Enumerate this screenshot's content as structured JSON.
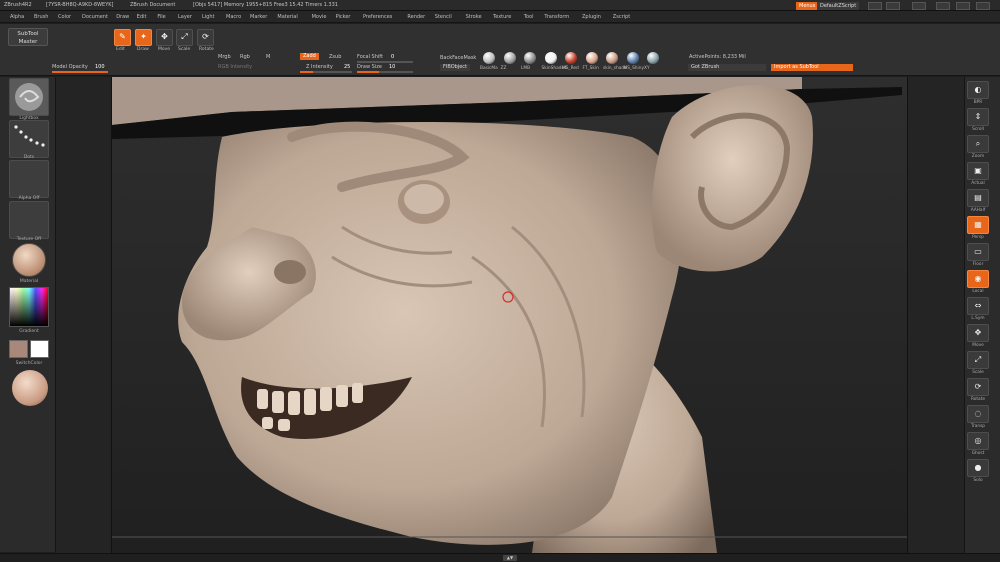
{
  "titlebar": {
    "app": "ZBrush4R2",
    "serial": "[7YSR-BH8Q-A9KD-8WEYK]",
    "doc": "ZBrush Document",
    "stats": "[Objs 5417] Memory 1955+815 Free3 15.42 Timers 1.331",
    "menus_label": "Menus",
    "script_label": "DefaultZScript"
  },
  "menubar": {
    "items": [
      "Alpha",
      "Brush",
      "Color",
      "Document",
      "Draw",
      "Edit",
      "File",
      "Layer",
      "Light",
      "Macro",
      "Marker",
      "Material",
      "Movie",
      "Picker",
      "Preferences",
      "Render",
      "Stencil",
      "Stroke",
      "Texture",
      "Tool",
      "Transform",
      "Zplugin",
      "Zscript"
    ]
  },
  "shelf": {
    "subtool_master": [
      "SubTool",
      "Master"
    ],
    "model_opacity_label": "Model Opacity",
    "model_opacity_value": "100",
    "model_opacity": 1.0,
    "tools": [
      {
        "label": "Edit",
        "icon": "edit-icon",
        "glyph": "✎",
        "on": true
      },
      {
        "label": "Draw",
        "icon": "draw-icon",
        "glyph": "✦",
        "on": true
      },
      {
        "label": "Move",
        "icon": "move-icon",
        "glyph": "✥",
        "on": false
      },
      {
        "label": "Scale",
        "icon": "scale-icon",
        "glyph": "⤢",
        "on": false
      },
      {
        "label": "Rotate",
        "icon": "rotate-icon",
        "glyph": "⟳",
        "on": false
      }
    ],
    "mrgb": "Mrgb",
    "rgb": "Rgb",
    "m": "M",
    "rgb_intensity": "RGB Intensity",
    "zadd": "Zadd",
    "zsub": "Zsub",
    "z_intensity_label": "Z Intensity",
    "z_intensity_value": "25",
    "z_intensity": 0.25,
    "focal_shift_label": "Focal Shift",
    "focal_shift_value": "0",
    "draw_size_label": "Draw Size",
    "draw_size_value": "10",
    "backface_mask": "BackFaceMask",
    "fiber_object": "FIBObject",
    "active_points": "ActivePoints: 8,233 Mil",
    "got_zbrush": "Got ZBrush",
    "import_as_subtool": "Import as SubTool"
  },
  "materials": [
    {
      "name": "BasicMa",
      "color": "#bdbdbd"
    },
    {
      "name": "ZZ",
      "color": "#a0a0a0"
    },
    {
      "name": "LMB",
      "color": "#8c8c8c"
    },
    {
      "name": "SkinShade4",
      "color": "#f0f0f0"
    },
    {
      "name": "MS_Red",
      "color": "#c8402a"
    },
    {
      "name": "FT_Skin",
      "color": "#d9a58c"
    },
    {
      "name": "skin_shade",
      "color": "#c89a82"
    },
    {
      "name": "MS_Shiny",
      "color": "#5a7fae"
    },
    {
      "name": "XY",
      "color": "#8aa0a8"
    }
  ],
  "lefttray": {
    "thumbs": [
      "Lightbox",
      "Dots",
      "Alpha Off",
      "Texture Off",
      "Material",
      "Gradient",
      "SwitchColor"
    ]
  },
  "righttray": {
    "buttons": [
      {
        "label": "BPR",
        "icon": "bpr-icon",
        "glyph": "◐",
        "on": false
      },
      {
        "label": "Scroll",
        "icon": "scroll-icon",
        "glyph": "⇕",
        "on": false
      },
      {
        "label": "Zoom",
        "icon": "zoom-icon",
        "glyph": "⌕",
        "on": false
      },
      {
        "label": "Actual",
        "icon": "actual-icon",
        "glyph": "▣",
        "on": false
      },
      {
        "label": "AAHalf",
        "icon": "aahalf-icon",
        "glyph": "▤",
        "on": false
      },
      {
        "label": "Persp",
        "icon": "persp-icon",
        "glyph": "▦",
        "on": true
      },
      {
        "label": "Floor",
        "icon": "floor-icon",
        "glyph": "▭",
        "on": false
      },
      {
        "label": "Local",
        "icon": "local-icon",
        "glyph": "◉",
        "on": true
      },
      {
        "label": "L.Sym",
        "icon": "lsym-icon",
        "glyph": "⇔",
        "on": false
      },
      {
        "label": "Move",
        "icon": "move-view-icon",
        "glyph": "✥",
        "on": false
      },
      {
        "label": "Scale",
        "icon": "scale-view-icon",
        "glyph": "⤢",
        "on": false
      },
      {
        "label": "Rotate",
        "icon": "rotate-view-icon",
        "glyph": "⟳",
        "on": false
      },
      {
        "label": "Transp",
        "icon": "transp-icon",
        "glyph": "◌",
        "on": false
      },
      {
        "label": "Ghost",
        "icon": "ghost-icon",
        "glyph": "◎",
        "on": false
      },
      {
        "label": "Solo",
        "icon": "solo-icon",
        "glyph": "●",
        "on": false
      }
    ]
  },
  "bottombar": {
    "handle": "▲▼"
  },
  "colors": {
    "accent": "#e8661a",
    "clay": "#c8b3a0"
  }
}
